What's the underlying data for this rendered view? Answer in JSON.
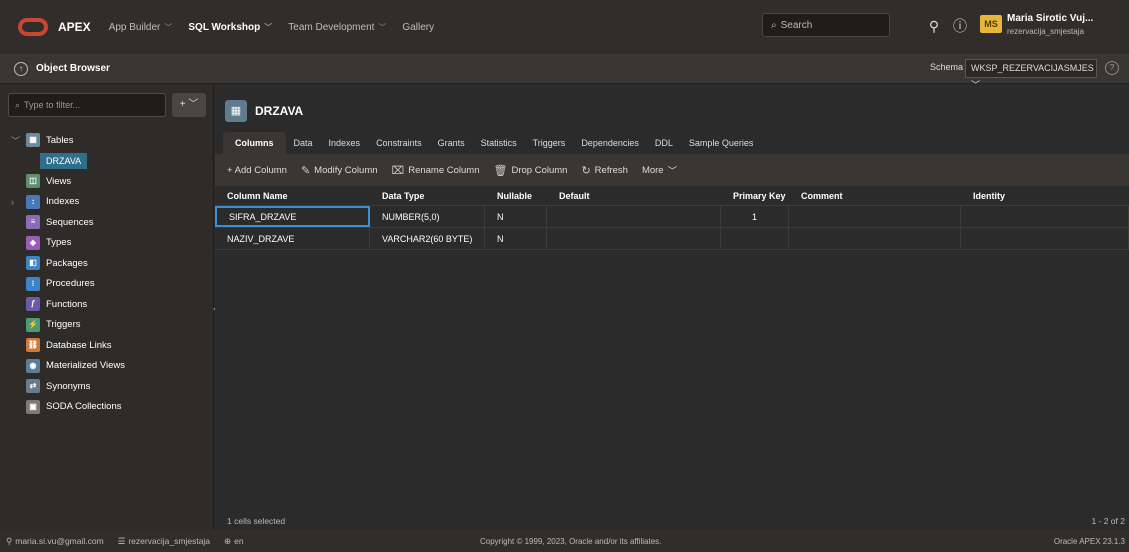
{
  "header": {
    "brand": "APEX",
    "nav": [
      {
        "label": "App Builder",
        "active": false
      },
      {
        "label": "SQL Workshop",
        "active": true
      },
      {
        "label": "Team Development",
        "active": false
      },
      {
        "label": "Gallery",
        "active": false
      }
    ],
    "search_placeholder": "Search",
    "avatar_initials": "MS",
    "user_name": "Maria Sirotic Vuj...",
    "user_workspace": "rezervacija_smjestaja"
  },
  "subbar": {
    "title": "Object Browser",
    "schema_label": "Schema",
    "schema_value": "WKSP_REZERVACIJASMJES"
  },
  "sidebar": {
    "filter_placeholder": "Type to filter...",
    "add_label": "+",
    "items": [
      {
        "label": "Tables",
        "icon": "table-icon",
        "color": "#6b8a9c"
      },
      {
        "label": "Views",
        "icon": "view-icon",
        "color": "#5e8f6f"
      },
      {
        "label": "Indexes",
        "icon": "index-icon",
        "color": "#4a78b5"
      },
      {
        "label": "Sequences",
        "icon": "sequence-icon",
        "color": "#8a6bb5"
      },
      {
        "label": "Types",
        "icon": "type-icon",
        "color": "#9b5bb8"
      },
      {
        "label": "Packages",
        "icon": "package-icon",
        "color": "#3d84c7"
      },
      {
        "label": "Procedures",
        "icon": "procedure-icon",
        "color": "#3d84c7"
      },
      {
        "label": "Functions",
        "icon": "function-icon",
        "color": "#6a5aa8"
      },
      {
        "label": "Triggers",
        "icon": "trigger-icon",
        "color": "#4a9b7a"
      },
      {
        "label": "Database Links",
        "icon": "dblink-icon",
        "color": "#d07a3a"
      },
      {
        "label": "Materialized Views",
        "icon": "mview-icon",
        "color": "#5a7d9a"
      },
      {
        "label": "Synonyms",
        "icon": "synonym-icon",
        "color": "#6b7b8a"
      },
      {
        "label": "SODA Collections",
        "icon": "soda-icon",
        "color": "#7a7a7a"
      }
    ],
    "selected_table": "DRZAVA"
  },
  "object": {
    "name": "DRZAVA",
    "tabs": [
      "Columns",
      "Data",
      "Indexes",
      "Constraints",
      "Grants",
      "Statistics",
      "Triggers",
      "Dependencies",
      "DDL",
      "Sample Queries"
    ],
    "toolbar": {
      "add_column": "+ Add Column",
      "modify_column": "Modify Column",
      "rename_column": "Rename Column",
      "drop_column": "Drop Column",
      "refresh": "Refresh",
      "more": "More"
    },
    "columns": [
      "Column Name",
      "Data Type",
      "Nullable",
      "Default",
      "Primary Key",
      "Comment",
      "Identity"
    ],
    "rows": [
      [
        "SIFRA_DRZAVE",
        "NUMBER(5,0)",
        "N",
        "",
        "1",
        "",
        ""
      ],
      [
        "NAZIV_DRZAVE",
        "VARCHAR2(60 BYTE)",
        "N",
        "",
        "",
        "",
        ""
      ]
    ],
    "status_selected": "1 cells selected",
    "status_count": "1 - 2 of 2"
  },
  "footer": {
    "email": "maria.si.vu@gmail.com",
    "workspace": "rezervacija_smjestaja",
    "language": "en",
    "copyright": "Copyright © 1999, 2023, Oracle and/or its affiliates.",
    "version": "Oracle APEX 23.1.3"
  }
}
